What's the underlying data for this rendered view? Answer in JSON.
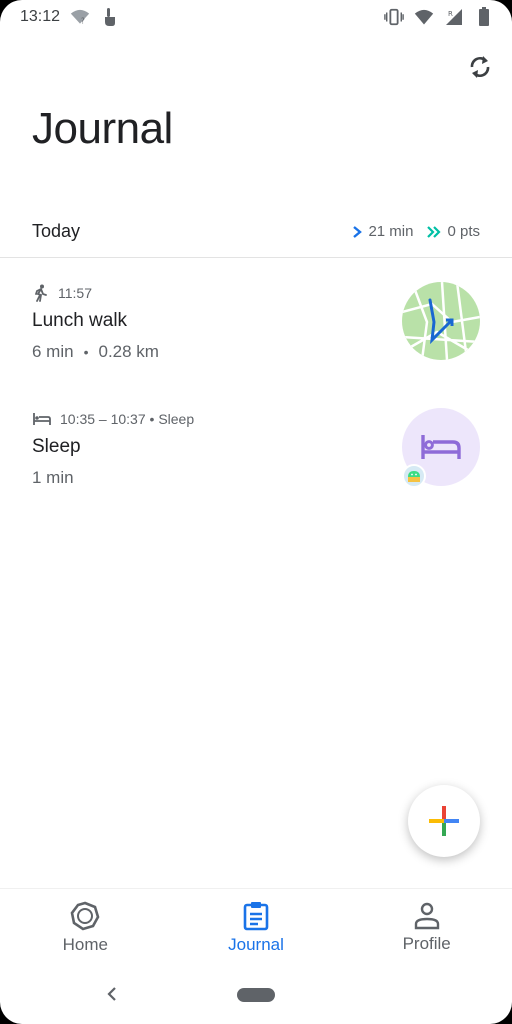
{
  "status_bar": {
    "time": "13:12",
    "icons": [
      "wifi-unknown-icon",
      "touch-icon",
      "vibrate-icon",
      "wifi-icon",
      "signal-icon",
      "battery-icon"
    ]
  },
  "header": {
    "title": "Journal",
    "sync_icon": "sync-icon"
  },
  "summary": {
    "label": "Today",
    "move_minutes": "21 min",
    "heart_points": "0 pts",
    "colors": {
      "move": "#1a73e8",
      "heart": "#00bfa5"
    }
  },
  "entries": [
    {
      "icon": "walk-icon",
      "time": "11:57",
      "title": "Lunch walk",
      "duration": "6 min",
      "separator": "•",
      "distance": "0.28 km",
      "thumbnail": "map-thumbnail"
    },
    {
      "icon": "bed-icon",
      "time": "10:35 – 10:37 • Sleep",
      "title": "Sleep",
      "duration": "1 min",
      "thumbnail": "bed-icon",
      "badge": "android-icon"
    }
  ],
  "fab": {
    "icon": "plus-icon"
  },
  "bottom_nav": {
    "items": [
      {
        "label": "Home",
        "icon": "home-ring-icon"
      },
      {
        "label": "Journal",
        "icon": "journal-icon",
        "active": true
      },
      {
        "label": "Profile",
        "icon": "person-icon"
      }
    ]
  },
  "colors": {
    "accent": "#1a73e8",
    "text": "#202124",
    "secondary": "#5f6368"
  }
}
